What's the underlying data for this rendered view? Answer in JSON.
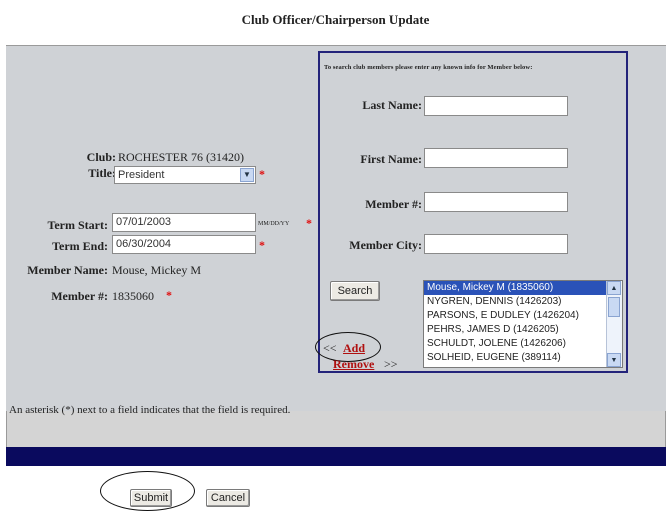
{
  "page": {
    "title": "Club Officer/Chairperson Update"
  },
  "left": {
    "club_label": "Club:",
    "club_value": "ROCHESTER 76 (31420)",
    "title_label": "Title:",
    "title_value": "President",
    "term_start_label": "Term Start:",
    "term_start_value": "07/01/2003",
    "date_format": "MM/DD/YY",
    "term_end_label": "Term End:",
    "term_end_value": "06/30/2004",
    "member_name_label": "Member Name:",
    "member_name_value": "Mouse, Mickey M",
    "member_num_label": "Member #:",
    "member_num_value": "1835060",
    "required_mark": "*"
  },
  "search": {
    "hint": "To search club members please enter any known info for Member below:",
    "last_name_label": "Last Name:",
    "last_name_value": "",
    "first_name_label": "First Name:",
    "first_name_value": "",
    "member_num_label": "Member #:",
    "member_num_value": "",
    "member_city_label": "Member City:",
    "member_city_value": "",
    "search_button": "Search",
    "add_prefix": "<<",
    "add_link": "Add",
    "remove_link": "Remove",
    "remove_suffix": ">>",
    "results": [
      "Mouse, Mickey M (1835060)",
      "NYGREN, DENNIS (1426203)",
      "PARSONS, E DUDLEY (1426204)",
      "PEHRS, JAMES D (1426205)",
      "SCHULDT, JOLENE (1426206)",
      "SOLHEID, EUGENE (389114)"
    ]
  },
  "footer": {
    "note": "An asterisk (*) next to a field indicates that the field is required.",
    "submit": "Submit",
    "cancel": "Cancel"
  },
  "colors": {
    "panel": "#cfd2d6",
    "navy": "#0a0a5e",
    "required": "#e01010",
    "selection": "#2a52b8",
    "link": "#b01010"
  }
}
